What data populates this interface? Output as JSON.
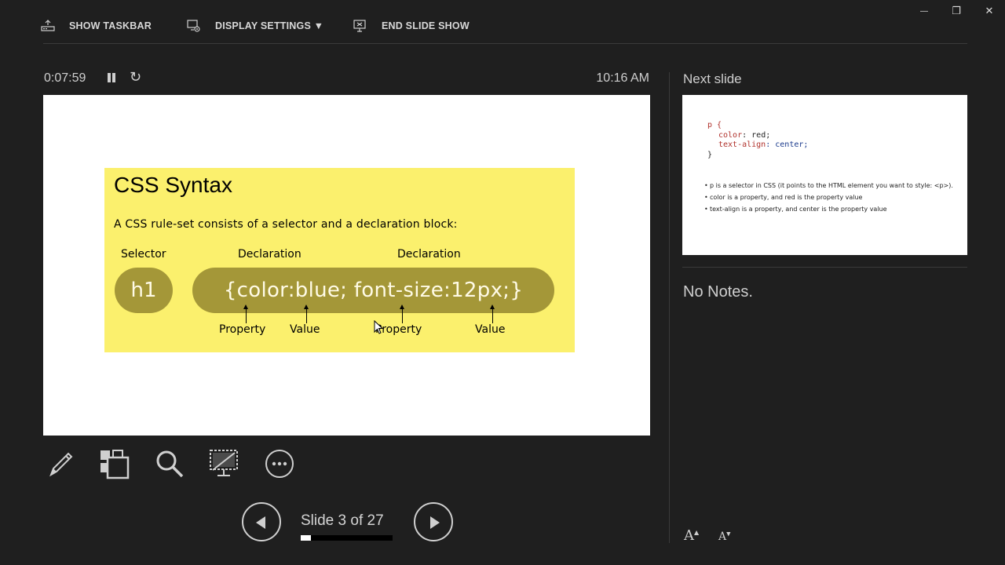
{
  "toolbar": {
    "show_taskbar": "SHOW TASKBAR",
    "display_settings": "DISPLAY SETTINGS ▼",
    "end_slide_show": "END SLIDE SHOW"
  },
  "window_controls": {
    "minimize": "—",
    "restore": "❐",
    "close": "✕"
  },
  "timer": {
    "elapsed": "0:07:59",
    "clock": "10:16 AM"
  },
  "current_slide": {
    "title": "CSS Syntax",
    "description": "A CSS rule-set consists of a selector and a declaration block:",
    "selector_label": "Selector",
    "declaration_label_1": "Declaration",
    "declaration_label_2": "Declaration",
    "selector_value": "h1",
    "declaration_code": "{color:blue; font-size:12px;}",
    "property_label_1": "Property",
    "value_label_1": "Value",
    "property_label_2": "Property",
    "value_label_2": "Value",
    "bg_color": "#fbf06d",
    "pill_color": "#a49738"
  },
  "navigation": {
    "slide_counter": "Slide 3 of 27",
    "current": 3,
    "total": 27,
    "progress_fraction": 0.111
  },
  "next_slide": {
    "heading": "Next slide",
    "code_line_1": "p {",
    "code_line_2a": "color",
    "code_line_2b": ": red;",
    "code_line_3a": "text-align",
    "code_line_3b": ": center;",
    "code_line_4": "}",
    "bullet_1": "p is a selector in CSS (it points to the HTML element you want to style: <p>).",
    "bullet_2": "color is a property, and red is the property value",
    "bullet_3": "text-align is a property, and center is the property value"
  },
  "notes": {
    "text": "No Notes."
  },
  "font_buttons": {
    "increase": "A",
    "decrease": "A"
  },
  "tools": [
    "pen-tool",
    "see-all-slides",
    "zoom",
    "black-screen",
    "more-options"
  ]
}
